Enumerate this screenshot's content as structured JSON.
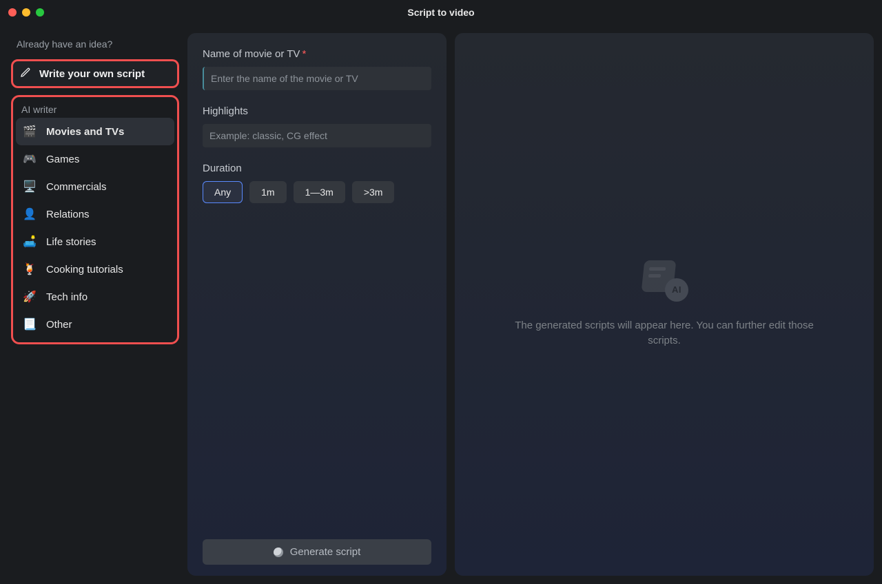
{
  "window": {
    "title": "Script to video"
  },
  "sidebar": {
    "idea_heading": "Already have an idea?",
    "write_own_label": "Write your own script",
    "ai_writer_heading": "AI writer",
    "categories": [
      {
        "label": "Movies and TVs",
        "icon": "🎬",
        "selected": true
      },
      {
        "label": "Games",
        "icon": "🎮",
        "selected": false
      },
      {
        "label": "Commercials",
        "icon": "🖥️",
        "selected": false
      },
      {
        "label": "Relations",
        "icon": "👤",
        "selected": false
      },
      {
        "label": "Life stories",
        "icon": "🛋️",
        "selected": false
      },
      {
        "label": "Cooking tutorials",
        "icon": "🍹",
        "selected": false
      },
      {
        "label": "Tech info",
        "icon": "🚀",
        "selected": false
      },
      {
        "label": "Other",
        "icon": "📃",
        "selected": false
      }
    ]
  },
  "form": {
    "name_label": "Name of movie or TV",
    "name_placeholder": "Enter the name of the movie or TV",
    "name_value": "",
    "highlights_label": "Highlights",
    "highlights_placeholder": "Example: classic, CG effect",
    "highlights_value": "",
    "duration_label": "Duration",
    "duration_options": [
      "Any",
      "1m",
      "1—3m",
      ">3m"
    ],
    "duration_selected": "Any",
    "generate_label": "Generate script"
  },
  "preview": {
    "ai_badge": "AI",
    "empty_message": "The generated scripts will appear here. You can further edit those scripts."
  },
  "colors": {
    "highlight_border": "#f04f4f",
    "accent": "#5a8aff"
  }
}
